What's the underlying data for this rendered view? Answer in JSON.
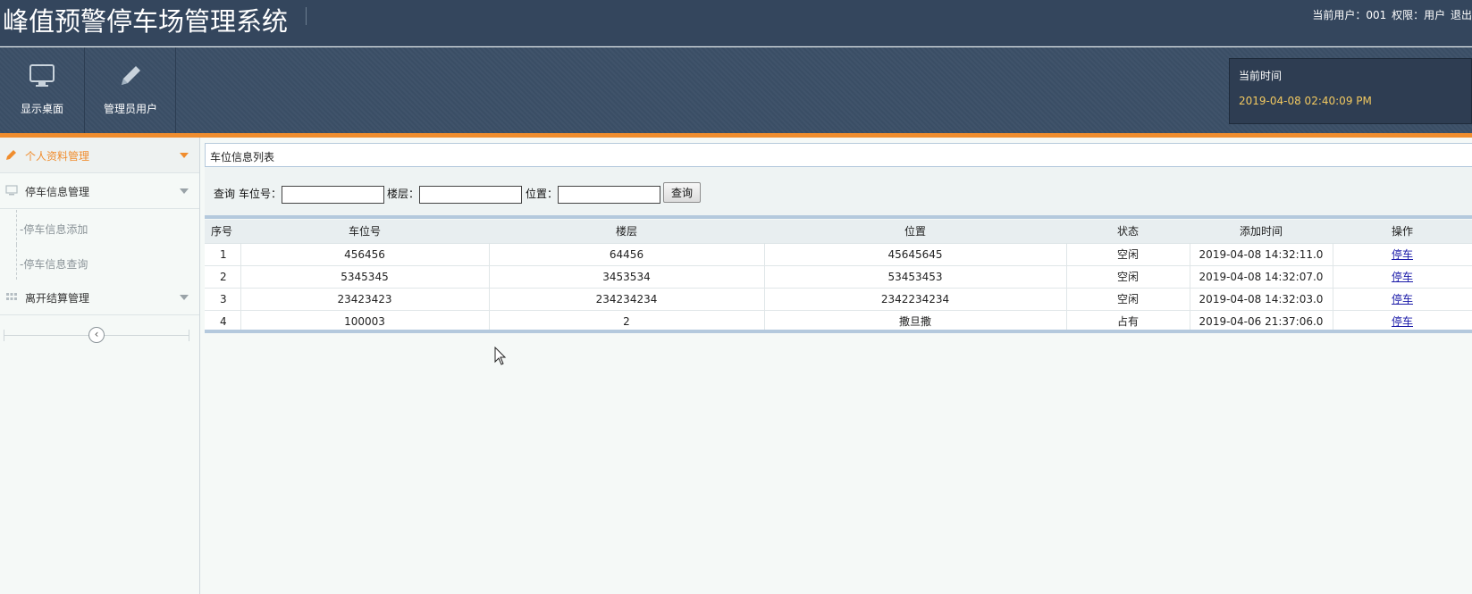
{
  "header": {
    "title": "峰值预警停车场管理系统",
    "user_info": [
      "当前用户：001",
      "权限：用户",
      "退出"
    ]
  },
  "toolbar": {
    "buttons": [
      {
        "label": "显示桌面",
        "icon": "monitor-icon"
      },
      {
        "label": "管理员用户",
        "icon": "pencil-icon"
      }
    ],
    "time_label": "当前时间",
    "time_value": "2019-04-08 02:40:09 PM"
  },
  "sidebar": {
    "groups": [
      {
        "label": "个人资料管理",
        "icon": "pencil-icon",
        "active": true
      },
      {
        "label": "停车信息管理",
        "icon": "monitor-icon",
        "items": [
          "-停车信息添加",
          "-停车信息查询"
        ]
      },
      {
        "label": "离开结算管理",
        "icon": "grid-icon"
      }
    ],
    "collapse_icon": "chevron-left-icon"
  },
  "main": {
    "panel_title": "车位信息列表",
    "search": {
      "prefix": "查询",
      "fields": [
        {
          "label": "车位号：",
          "value": ""
        },
        {
          "label": "楼层：",
          "value": ""
        },
        {
          "label": "位置：",
          "value": ""
        }
      ],
      "button": "查询"
    },
    "table": {
      "columns": [
        "序号",
        "车位号",
        "楼层",
        "位置",
        "状态",
        "添加时间",
        "操作"
      ],
      "rows": [
        [
          "1",
          "456456",
          "64456",
          "45645645",
          "空闲",
          "2019-04-08 14:32:11.0",
          "停车"
        ],
        [
          "2",
          "5345345",
          "3453534",
          "53453453",
          "空闲",
          "2019-04-08 14:32:07.0",
          "停车"
        ],
        [
          "3",
          "23423423",
          "234234234",
          "2342234234",
          "空闲",
          "2019-04-08 14:32:03.0",
          "停车"
        ],
        [
          "4",
          "100003",
          "2",
          "撒旦撒",
          "占有",
          "2019-04-06 21:37:06.0",
          "停车"
        ]
      ]
    }
  },
  "colors": {
    "header_bg": "#34465d",
    "accent": "#f08d2e",
    "time_value": "#f2c960",
    "link": "#1a1aa8"
  }
}
